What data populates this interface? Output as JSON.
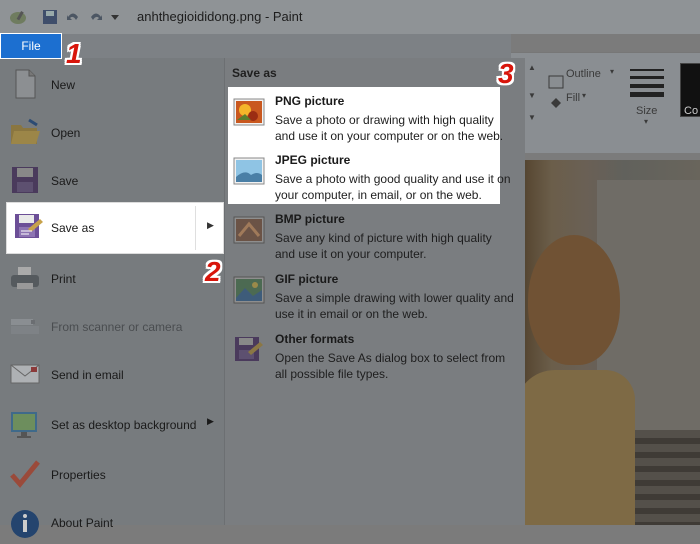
{
  "window": {
    "title": "anhthegioididong.png - Paint"
  },
  "file_tab": {
    "label": "File"
  },
  "ribbon": {
    "outline_label": "Outline",
    "fill_label": "Fill",
    "size_label": "Size",
    "color_label": "Co"
  },
  "menu": {
    "items": [
      {
        "label": "New"
      },
      {
        "label": "Open"
      },
      {
        "label": "Save"
      },
      {
        "label": "Save as"
      },
      {
        "label": "Print"
      },
      {
        "label": "From scanner or camera"
      },
      {
        "label": "Send in email"
      },
      {
        "label": "Set as desktop background"
      },
      {
        "label": "Properties"
      },
      {
        "label": "About Paint"
      }
    ]
  },
  "save_as": {
    "title": "Save as",
    "options": [
      {
        "title": "PNG picture",
        "description": "Save a photo or drawing with high quality and use it on your computer or on the web."
      },
      {
        "title": "JPEG picture",
        "description": "Save a photo with good quality and use it on your computer, in email, or on the web."
      },
      {
        "title": "BMP picture",
        "description": "Save any kind of picture with high quality and use it on your computer."
      },
      {
        "title": "GIF picture",
        "description": "Save a simple drawing with lower quality and use it in email or on the web."
      },
      {
        "title": "Other formats",
        "description": "Open the Save As dialog box to select from all possible file types."
      }
    ]
  },
  "badges": {
    "one": "1",
    "two": "2",
    "three": "3"
  }
}
